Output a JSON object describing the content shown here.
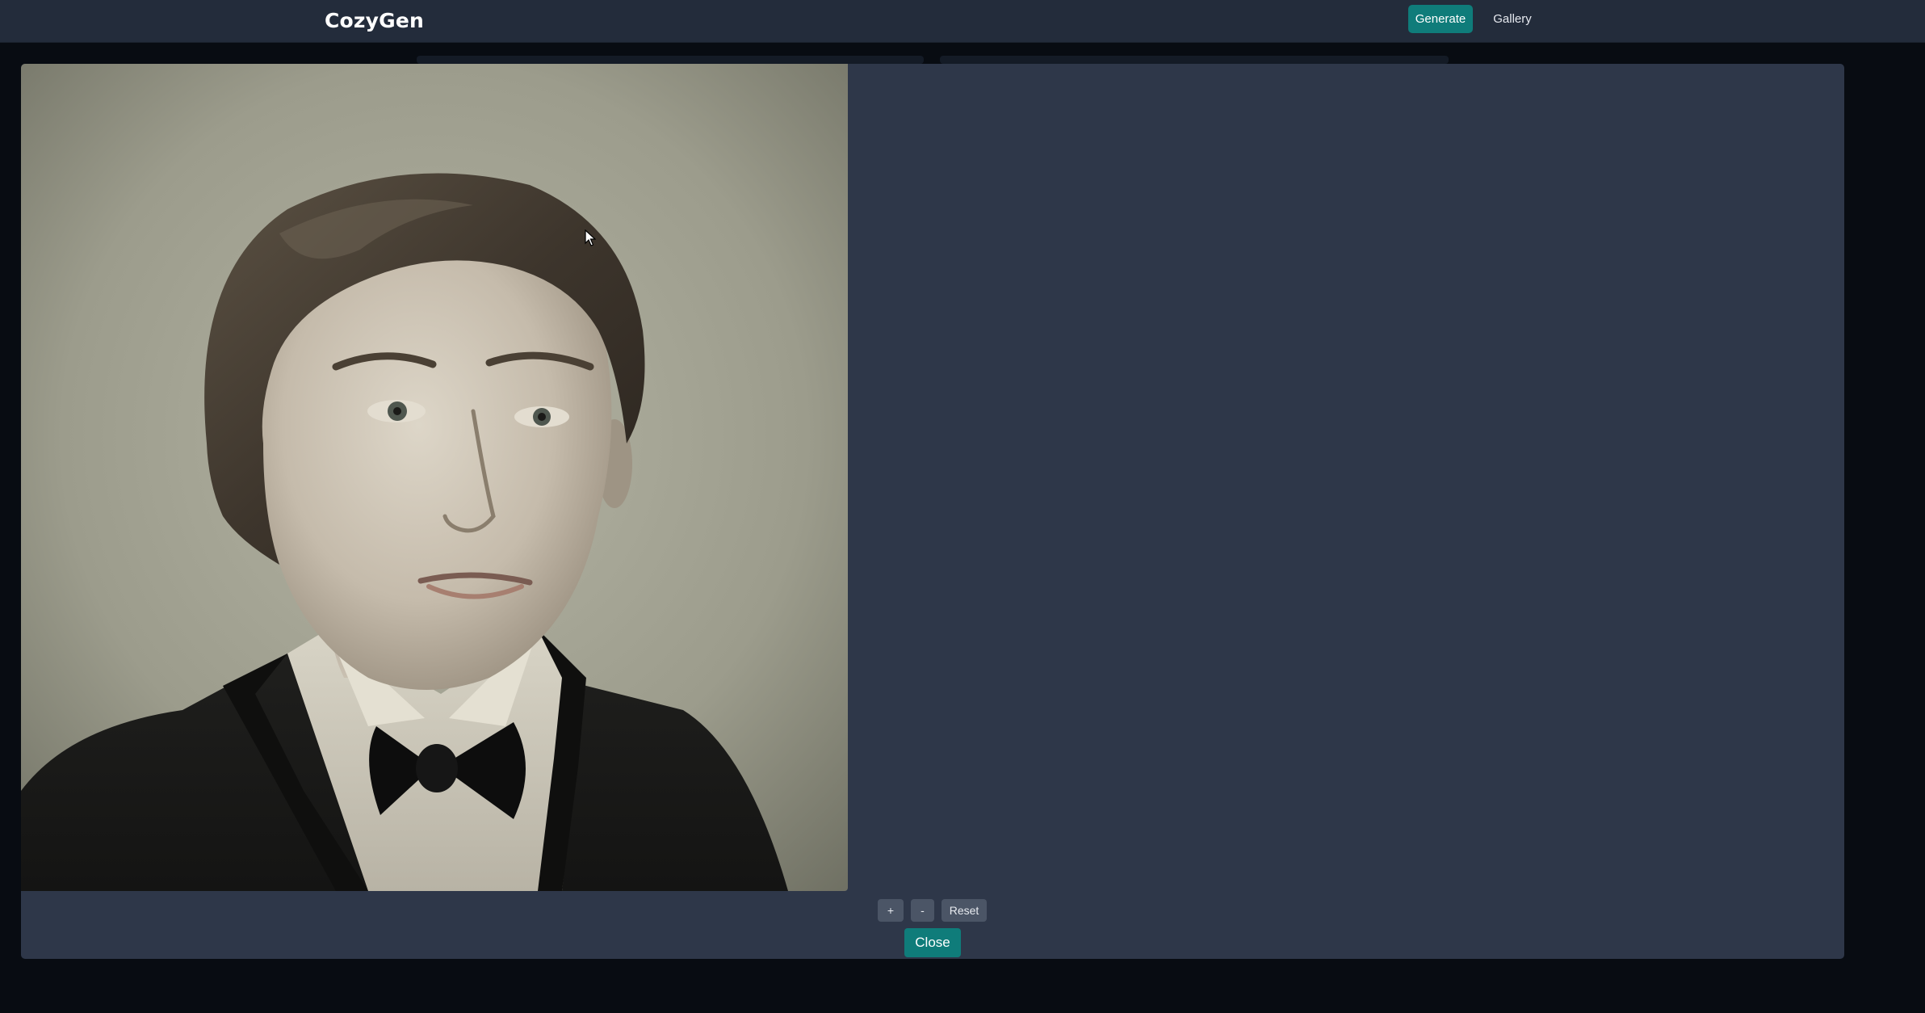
{
  "header": {
    "brand": "CozyGen",
    "nav": {
      "generate_label": "Generate",
      "gallery_label": "Gallery"
    }
  },
  "viewer": {
    "image_alt": "Vintage portrait of a young man in a black tuxedo and bow tie",
    "zoom_in_label": "+",
    "zoom_out_label": "-",
    "reset_label": "Reset",
    "close_label": "Close"
  },
  "colors": {
    "accent": "#0f7c7a",
    "topbar": "#232c3b",
    "modal": "#2e3749",
    "page_bg": "#080c12",
    "button_gray": "#4b5566"
  },
  "icons": {
    "cursor": "mouse-pointer-icon"
  }
}
